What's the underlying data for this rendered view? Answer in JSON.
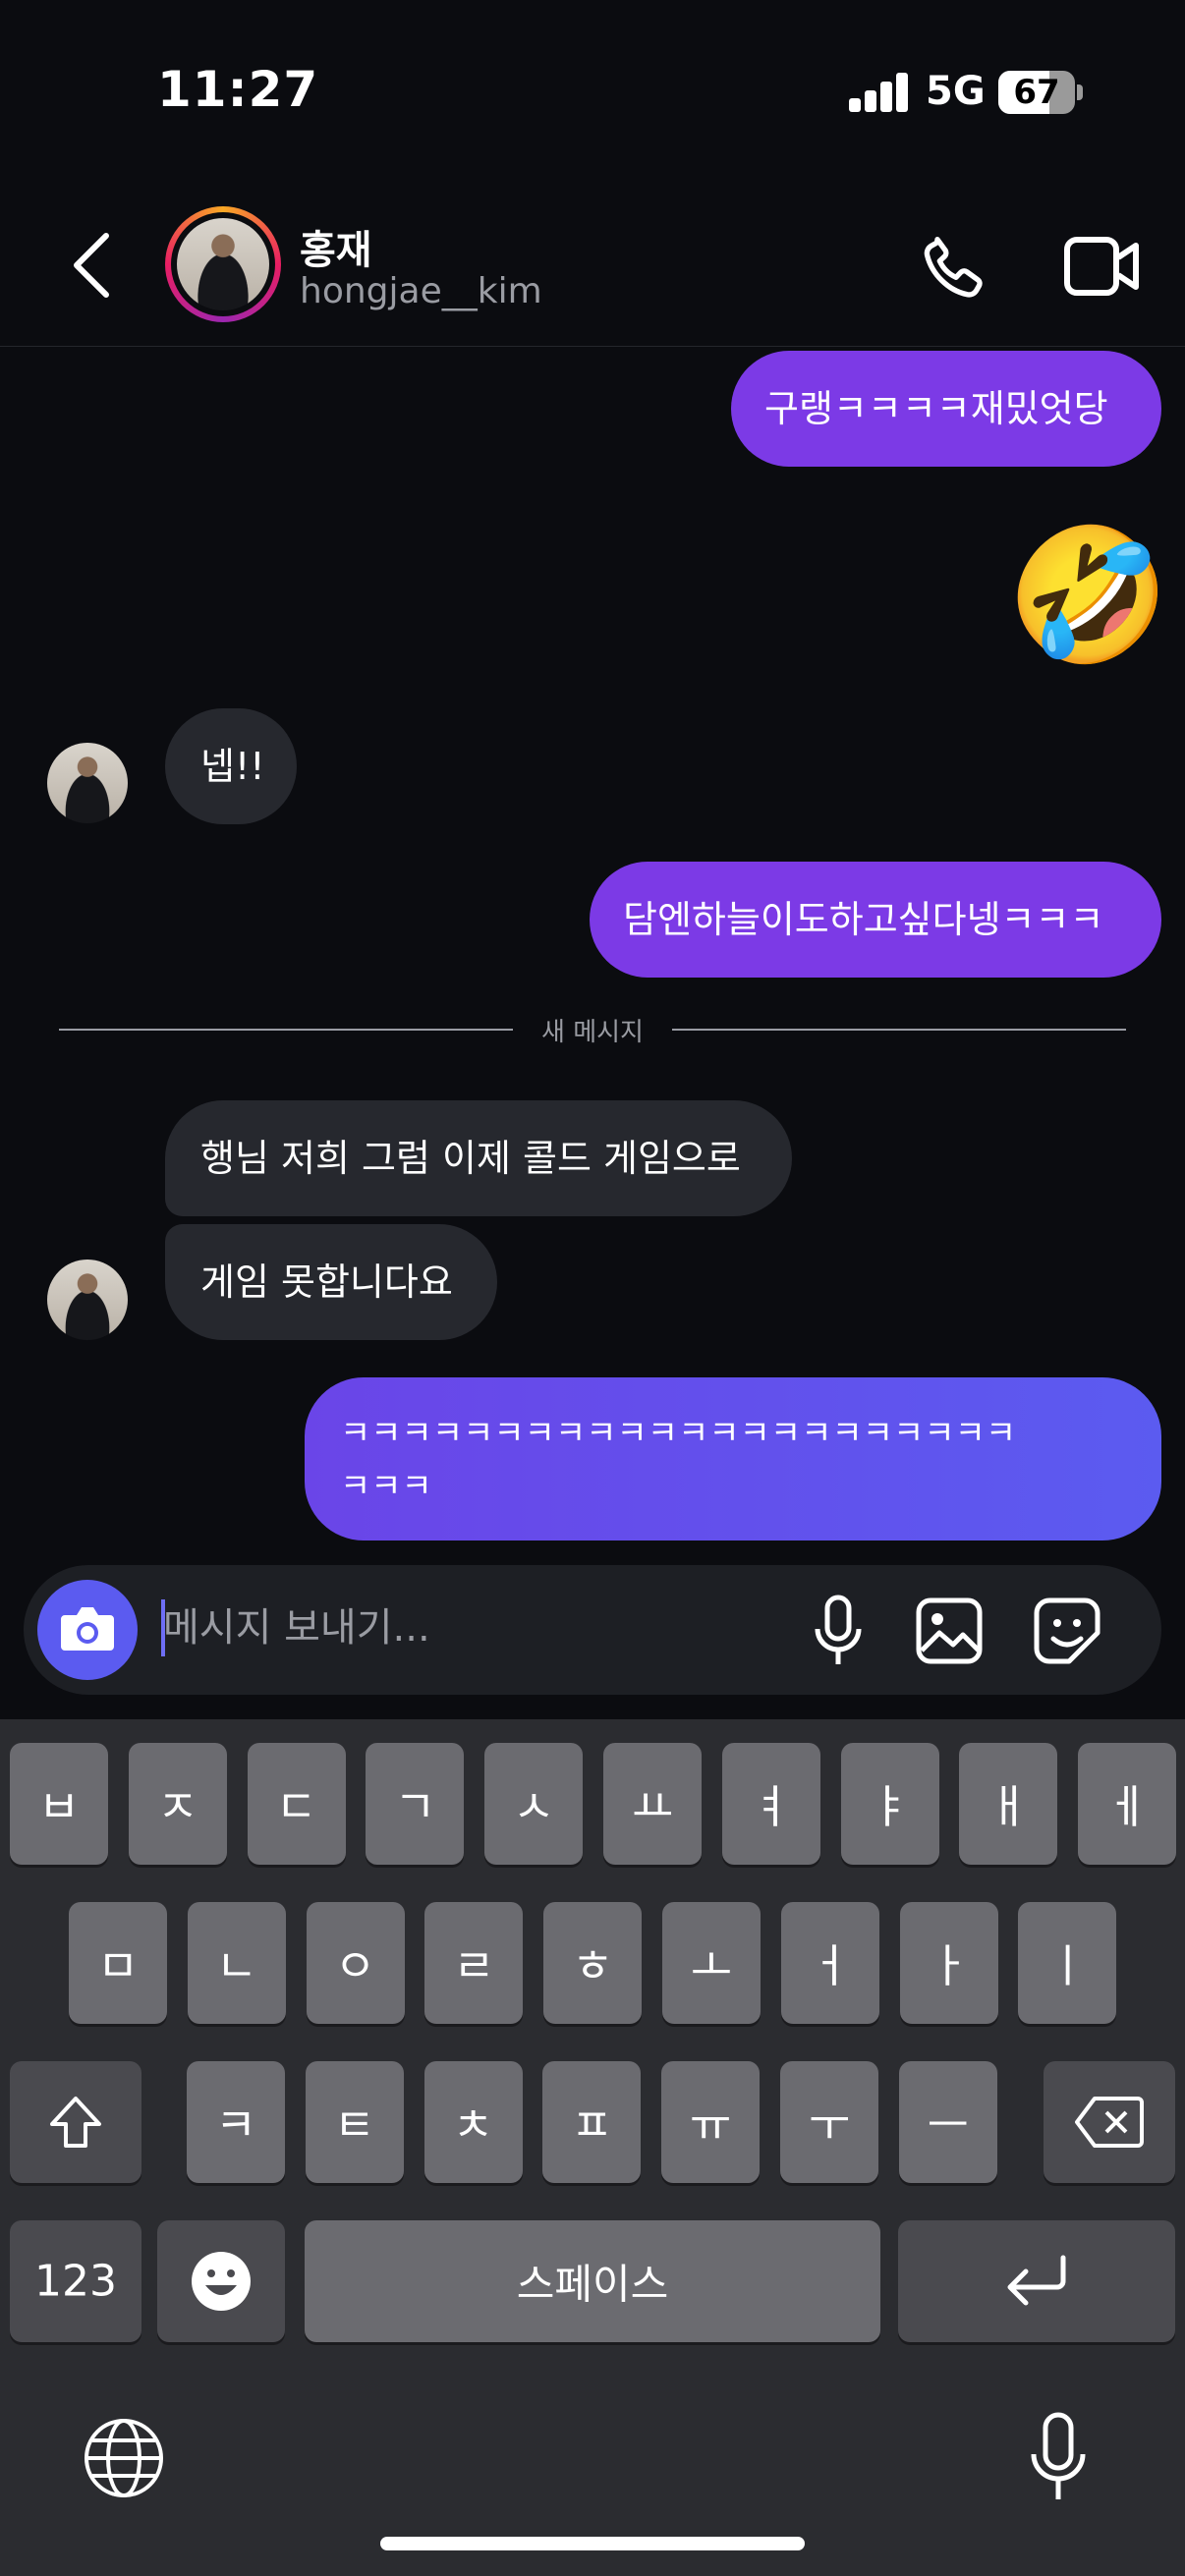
{
  "status_bar": {
    "time": "11:27",
    "network": "5G",
    "battery": "67",
    "battery_level": 0.67
  },
  "header": {
    "name": "홍재",
    "username": "hongjae__kim"
  },
  "messages": {
    "m1": "구랭ㅋㅋㅋㅋ재밌엇당",
    "m2": "🤣",
    "m3": "넵!!",
    "m4": "담엔하늘이도하고싶다넹ㅋㅋㅋ",
    "m5": "행님 저희 그럼 이제 콜드 게임으로",
    "m6": "게임 못합니다요",
    "m7a": "ㅋㅋㅋㅋㅋㅋㅋㅋㅋㅋㅋㅋㅋㅋㅋㅋㅋㅋㅋㅋㅋㅋ",
    "m7b": "ㅋㅋㅋ"
  },
  "divider": {
    "label": "새 메시지"
  },
  "composer": {
    "placeholder": "메시지 보내기..."
  },
  "keyboard": {
    "row1": [
      "ㅂ",
      "ㅈ",
      "ㄷ",
      "ㄱ",
      "ㅅ",
      "ㅛ",
      "ㅕ",
      "ㅑ",
      "ㅐ",
      "ㅔ"
    ],
    "row2": [
      "ㅁ",
      "ㄴ",
      "ㅇ",
      "ㄹ",
      "ㅎ",
      "ㅗ",
      "ㅓ",
      "ㅏ",
      "ㅣ"
    ],
    "row3": [
      "ㅋ",
      "ㅌ",
      "ㅊ",
      "ㅍ",
      "ㅠ",
      "ㅜ",
      "ㅡ"
    ],
    "numbers_label": "123",
    "space_label": "스페이스"
  },
  "icons": [
    "back-icon",
    "phone-icon",
    "video-icon",
    "camera-icon",
    "mic-icon",
    "gallery-icon",
    "sticker-icon",
    "shift-icon",
    "backspace-icon",
    "emoji-icon",
    "return-icon",
    "globe-icon",
    "dictation-icon"
  ],
  "colors": {
    "outgoing": "#7c3ae6",
    "outgoing_gradient_end": "#5b5bf0",
    "incoming": "#26282e",
    "accent": "#5b5bf0"
  }
}
